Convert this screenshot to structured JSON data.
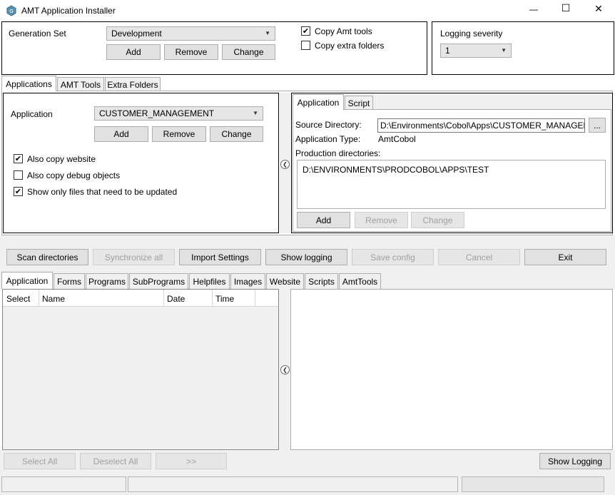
{
  "window": {
    "title": "AMT Application Installer",
    "controls": {
      "minimize": "—",
      "maximize": "☐",
      "close": "✕"
    }
  },
  "generation_set": {
    "label": "Generation Set",
    "value": "Development",
    "add": "Add",
    "remove": "Remove",
    "change": "Change",
    "copy_amt_tools": {
      "label": "Copy Amt tools",
      "checked": true
    },
    "copy_extra_folders": {
      "label": "Copy extra folders",
      "checked": false
    }
  },
  "logging": {
    "label": "Logging severity",
    "value": "1"
  },
  "top_tabs": [
    "Applications",
    "AMT Tools",
    "Extra Folders"
  ],
  "application_panel": {
    "label": "Application",
    "value": "CUSTOMER_MANAGEMENT",
    "add": "Add",
    "remove": "Remove",
    "change": "Change",
    "options": [
      {
        "label": "Also copy website",
        "checked": true
      },
      {
        "label": "Also copy debug objects",
        "checked": false
      },
      {
        "label": "Show only files that need to be updated",
        "checked": true
      }
    ]
  },
  "detail_tabs": [
    "Application",
    "Script"
  ],
  "details": {
    "source_label": "Source Directory:",
    "source_value": "D:\\Environments\\Cobol\\Apps\\CUSTOMER_MANAGEM",
    "browse": "...",
    "type_label": "Application Type:",
    "type_value": "AmtCobol",
    "prod_label": "Production directories:",
    "prod_items": [
      "D:\\ENVIRONMENTS\\PRODCOBOL\\APPS\\TEST"
    ],
    "add": "Add",
    "remove": "Remove",
    "change": "Change"
  },
  "toolbar": {
    "scan": "Scan directories",
    "sync": "Synchronize all",
    "import": "Import Settings",
    "show_logging": "Show logging",
    "save_config": "Save config",
    "cancel": "Cancel",
    "exit": "Exit"
  },
  "bottom_tabs": [
    "Application",
    "Forms",
    "Programs",
    "SubPrograms",
    "Helpfiles",
    "Images",
    "Website",
    "Scripts",
    "AmtTools"
  ],
  "grid": {
    "columns": [
      "Select",
      "Name",
      "Date",
      "Time"
    ]
  },
  "bottom_buttons": {
    "select_all": "Select All",
    "deselect_all": "Deselect All",
    "forward": ">>",
    "show_logging": "Show Logging"
  },
  "collapse_arrow": "❮",
  "check_mark": "✔"
}
